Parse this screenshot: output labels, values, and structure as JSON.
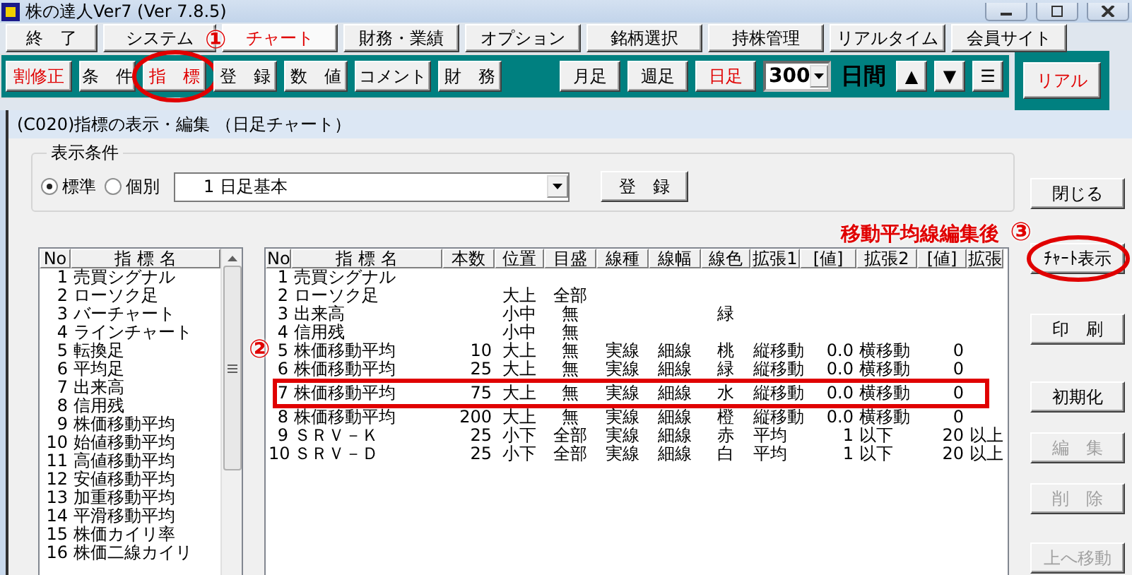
{
  "window": {
    "title": "株の達人Ver7 (Ver 7.8.5)"
  },
  "menu": [
    {
      "label": "終　了",
      "selected": false
    },
    {
      "label": "システム",
      "selected": false
    },
    {
      "label": "チャート",
      "selected": true,
      "marker": "①"
    },
    {
      "label": "財務・業績",
      "selected": false
    },
    {
      "label": "オプション",
      "selected": false
    },
    {
      "label": "銘柄選択",
      "selected": false
    },
    {
      "label": "持株管理",
      "selected": false
    },
    {
      "label": "リアルタイム",
      "selected": false
    },
    {
      "label": "会員サイト",
      "selected": false
    }
  ],
  "toolbar": {
    "buttons": [
      {
        "label": "割修正",
        "active": true,
        "circled": false
      },
      {
        "label": "条　件",
        "active": false,
        "circled": false
      },
      {
        "label": "指　標",
        "active": true,
        "circled": true
      },
      {
        "label": "登　録",
        "active": false,
        "circled": false
      },
      {
        "label": "数　値",
        "active": false,
        "circled": false
      },
      {
        "label": "コメント",
        "active": false,
        "circled": false
      },
      {
        "label": "財　務",
        "active": false,
        "circled": false
      }
    ],
    "periods": [
      {
        "label": "月足",
        "selected": false
      },
      {
        "label": "週足",
        "selected": false
      },
      {
        "label": "日足",
        "selected": true
      }
    ],
    "days_select": "300",
    "days_label": "日間",
    "arrows": [
      "▲",
      "▼",
      "☰"
    ],
    "realtime_button": "リアル"
  },
  "dialog": {
    "title": "(C020)指標の表示・編集 （日足チャート）",
    "conditions": {
      "title": "表示条件",
      "radios": [
        {
          "label": "標準",
          "selected": true
        },
        {
          "label": "個別",
          "selected": false
        }
      ],
      "preset": "1 日足基本",
      "register_button": "登　録"
    },
    "caption": {
      "text": "移動平均線編集後",
      "marker": "③"
    },
    "indicator_list": {
      "columns": [
        "No",
        "指 標 名"
      ],
      "rows": [
        {
          "no": "1",
          "name": "売買シグナル"
        },
        {
          "no": "2",
          "name": "ローソク足"
        },
        {
          "no": "3",
          "name": "バーチャート"
        },
        {
          "no": "4",
          "name": "ラインチャート"
        },
        {
          "no": "5",
          "name": "転換足"
        },
        {
          "no": "6",
          "name": "平均足"
        },
        {
          "no": "7",
          "name": "出来高"
        },
        {
          "no": "8",
          "name": "信用残"
        },
        {
          "no": "9",
          "name": "株価移動平均"
        },
        {
          "no": "10",
          "name": "始値移動平均"
        },
        {
          "no": "11",
          "name": "高値移動平均"
        },
        {
          "no": "12",
          "name": "安値移動平均"
        },
        {
          "no": "13",
          "name": "加重移動平均"
        },
        {
          "no": "14",
          "name": "平滑移動平均"
        },
        {
          "no": "15",
          "name": "株価カイリ率"
        },
        {
          "no": "16",
          "name": "株価二線カイリ"
        }
      ]
    },
    "table": {
      "columns": [
        "No",
        "指 標 名",
        "本数",
        "位置",
        "目盛",
        "線種",
        "線幅",
        "線色",
        "拡張1",
        "[値]",
        "拡張2",
        "[値]",
        "拡張"
      ],
      "rows": [
        {
          "no": "1",
          "name": "売買シグナル",
          "highlighted": false
        },
        {
          "no": "2",
          "name": "ローソク足",
          "position": "大上",
          "scale": "全部",
          "highlighted": false
        },
        {
          "no": "3",
          "name": "出来高",
          "position": "小中",
          "scale": "無",
          "line_color": "緑",
          "highlighted": false
        },
        {
          "no": "4",
          "name": "信用残",
          "position": "小中",
          "scale": "無",
          "highlighted": false
        },
        {
          "no": "5",
          "name": "株価移動平均",
          "count": "10",
          "position": "大上",
          "scale": "無",
          "line_type": "実線",
          "line_width": "細線",
          "line_color": "桃",
          "ext1": "縦移動",
          "value1": "0.0",
          "ext2": "横移動",
          "value2": "0",
          "highlighted": false,
          "marker": "②"
        },
        {
          "no": "6",
          "name": "株価移動平均",
          "count": "25",
          "position": "大上",
          "scale": "無",
          "line_type": "実線",
          "line_width": "細線",
          "line_color": "緑",
          "ext1": "縦移動",
          "value1": "0.0",
          "ext2": "横移動",
          "value2": "0",
          "highlighted": false
        },
        {
          "no": "7",
          "name": "株価移動平均",
          "count": "75",
          "position": "大上",
          "scale": "無",
          "line_type": "実線",
          "line_width": "細線",
          "line_color": "水",
          "ext1": "縦移動",
          "value1": "0.0",
          "ext2": "横移動",
          "value2": "0",
          "highlighted": true
        },
        {
          "no": "8",
          "name": "株価移動平均",
          "count": "200",
          "position": "大上",
          "scale": "無",
          "line_type": "実線",
          "line_width": "細線",
          "line_color": "橙",
          "ext1": "縦移動",
          "value1": "0.0",
          "ext2": "横移動",
          "value2": "0",
          "highlighted": false
        },
        {
          "no": "9",
          "name": "ＳＲＶ－Ｋ",
          "count": "25",
          "position": "小下",
          "scale": "全部",
          "line_type": "実線",
          "line_width": "細線",
          "line_color": "赤",
          "ext1": "平均",
          "value1": "1",
          "ext2": "以下",
          "value2": "20",
          "ext3": "以上",
          "highlighted": false
        },
        {
          "no": "10",
          "name": "ＳＲＶ－Ｄ",
          "count": "25",
          "position": "小下",
          "scale": "全部",
          "line_type": "実線",
          "line_width": "細線",
          "line_color": "白",
          "ext1": "平均",
          "value1": "1",
          "ext2": "以下",
          "value2": "20",
          "ext3": "以上",
          "highlighted": false
        }
      ]
    },
    "side_buttons": [
      {
        "label": "閉じる",
        "disabled": false,
        "circled": false
      },
      {
        "label": "ﾁｬｰﾄ表示",
        "disabled": false,
        "circled": true
      },
      {
        "label": "印　刷",
        "disabled": false,
        "circled": false
      },
      {
        "label": "初期化",
        "disabled": false,
        "circled": false
      },
      {
        "label": "編　集",
        "disabled": true,
        "circled": false
      },
      {
        "label": "削　除",
        "disabled": true,
        "circled": false
      },
      {
        "label": "上へ移動",
        "disabled": true,
        "circled": false
      }
    ]
  }
}
